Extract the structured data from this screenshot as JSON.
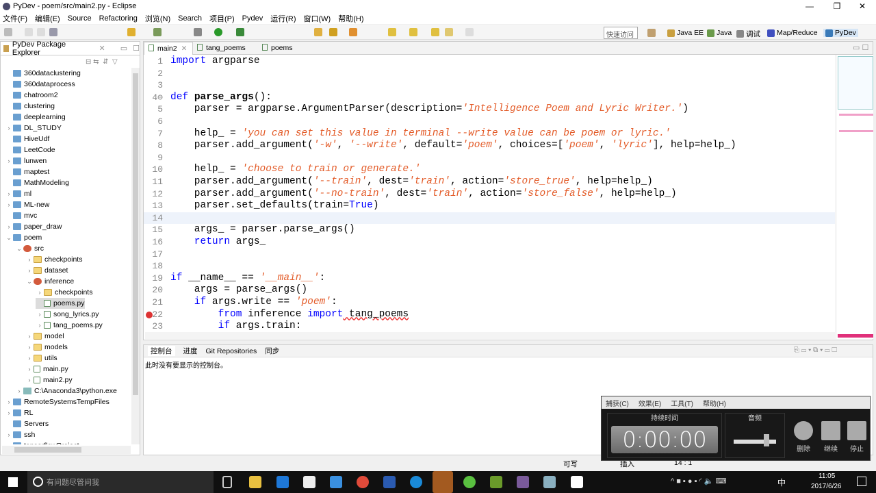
{
  "window": {
    "title": "PyDev - poem/src/main2.py - Eclipse",
    "minimize": "—",
    "maximize": "❐",
    "close": "✕"
  },
  "menu": [
    "文件(F)",
    "编辑(E)",
    "Source",
    "Refactoring",
    "浏览(N)",
    "Search",
    "项目(P)",
    "Pydev",
    "运行(R)",
    "窗口(W)",
    "帮助(H)"
  ],
  "toolbar": {
    "quick_access": "快速访问",
    "perspectives": [
      {
        "label": "Java EE",
        "color": "#c9a040"
      },
      {
        "label": "Java",
        "color": "#6a9a4a"
      },
      {
        "label": "调试",
        "color": "#888888"
      },
      {
        "label": "Map/Reduce",
        "color": "#4050c0"
      },
      {
        "label": "PyDev",
        "color": "#3a7ab8",
        "active": true
      }
    ]
  },
  "explorer": {
    "title": "PyDev Package Explorer",
    "tree": [
      {
        "label": "360dataclustering",
        "level": 0,
        "type": "project",
        "arrow": ""
      },
      {
        "label": "360dataprocess",
        "level": 0,
        "type": "project",
        "arrow": ""
      },
      {
        "label": "chatroom2",
        "level": 0,
        "type": "project",
        "arrow": ""
      },
      {
        "label": "clustering",
        "level": 0,
        "type": "project",
        "arrow": ""
      },
      {
        "label": "deeplearning",
        "level": 0,
        "type": "project",
        "arrow": ""
      },
      {
        "label": "DL_STUDY",
        "level": 0,
        "type": "project",
        "arrow": "›"
      },
      {
        "label": "HiveUdf",
        "level": 0,
        "type": "project",
        "arrow": ""
      },
      {
        "label": "LeetCode",
        "level": 0,
        "type": "project",
        "arrow": ""
      },
      {
        "label": "lunwen",
        "level": 0,
        "type": "project",
        "arrow": "›"
      },
      {
        "label": "maptest",
        "level": 0,
        "type": "project",
        "arrow": ""
      },
      {
        "label": "MathModeling",
        "level": 0,
        "type": "project",
        "arrow": ""
      },
      {
        "label": "ml",
        "level": 0,
        "type": "project",
        "arrow": "›"
      },
      {
        "label": "ML-new",
        "level": 0,
        "type": "project",
        "arrow": "›"
      },
      {
        "label": "mvc",
        "level": 0,
        "type": "project",
        "arrow": ""
      },
      {
        "label": "paper_draw",
        "level": 0,
        "type": "project",
        "arrow": "›"
      },
      {
        "label": "poem",
        "level": 0,
        "type": "project",
        "arrow": "⌄"
      },
      {
        "label": "src",
        "level": 1,
        "type": "package",
        "arrow": "⌄"
      },
      {
        "label": "checkpoints",
        "level": 2,
        "type": "folder",
        "arrow": "›"
      },
      {
        "label": "dataset",
        "level": 2,
        "type": "folder",
        "arrow": "›"
      },
      {
        "label": "inference",
        "level": 2,
        "type": "package",
        "arrow": "⌄"
      },
      {
        "label": "checkpoints",
        "level": 3,
        "type": "folder",
        "arrow": "›"
      },
      {
        "label": "poems.py",
        "level": 3,
        "type": "file",
        "arrow": "",
        "selected": true
      },
      {
        "label": "song_lyrics.py",
        "level": 3,
        "type": "file",
        "arrow": "›"
      },
      {
        "label": "tang_poems.py",
        "level": 3,
        "type": "file",
        "arrow": "›"
      },
      {
        "label": "model",
        "level": 2,
        "type": "folder",
        "arrow": "›"
      },
      {
        "label": "models",
        "level": 2,
        "type": "folder",
        "arrow": "›"
      },
      {
        "label": "utils",
        "level": 2,
        "type": "folder",
        "arrow": "›"
      },
      {
        "label": "main.py",
        "level": 2,
        "type": "file",
        "arrow": "›"
      },
      {
        "label": "main2.py",
        "level": 2,
        "type": "file",
        "arrow": "›"
      },
      {
        "label": "C:\\Anaconda3\\python.exe",
        "level": 1,
        "type": "interp",
        "arrow": "›"
      },
      {
        "label": "RemoteSystemsTempFiles",
        "level": 0,
        "type": "project",
        "arrow": "›"
      },
      {
        "label": "RL",
        "level": 0,
        "type": "project",
        "arrow": "›"
      },
      {
        "label": "Servers",
        "level": 0,
        "type": "project",
        "arrow": ""
      },
      {
        "label": "ssh",
        "level": 0,
        "type": "project",
        "arrow": "›"
      },
      {
        "label": "tensorflowProject",
        "level": 0,
        "type": "project",
        "arrow": "›"
      }
    ]
  },
  "editor": {
    "tabs": [
      {
        "label": "main2",
        "active": true
      },
      {
        "label": "tang_poems"
      },
      {
        "label": "poems"
      }
    ],
    "current_line": 14,
    "lines": [
      [
        [
          "kw",
          "import"
        ],
        [
          "pl",
          " argparse"
        ]
      ],
      [],
      [],
      [
        [
          "kw",
          "def "
        ],
        [
          "fn",
          "parse_args"
        ],
        [
          "pl",
          "():"
        ]
      ],
      [
        [
          "pl",
          "    parser = argparse.ArgumentParser(description="
        ],
        [
          "str",
          "'Intelligence Poem and Lyric Writer.'"
        ],
        [
          "pl",
          ")"
        ]
      ],
      [],
      [
        [
          "pl",
          "    help_ = "
        ],
        [
          "str",
          "'you can set this value in terminal --write value can be poem or lyric.'"
        ]
      ],
      [
        [
          "pl",
          "    parser.add_argument("
        ],
        [
          "str",
          "'-w'"
        ],
        [
          "pl",
          ", "
        ],
        [
          "str",
          "'--write'"
        ],
        [
          "pl",
          ", default="
        ],
        [
          "str",
          "'poem'"
        ],
        [
          "pl",
          ", choices=["
        ],
        [
          "str",
          "'poem'"
        ],
        [
          "pl",
          ", "
        ],
        [
          "str",
          "'lyric'"
        ],
        [
          "pl",
          "], help=help_)"
        ]
      ],
      [],
      [
        [
          "pl",
          "    help_ = "
        ],
        [
          "str",
          "'choose to train or generate.'"
        ]
      ],
      [
        [
          "pl",
          "    parser.add_argument("
        ],
        [
          "str",
          "'--train'"
        ],
        [
          "pl",
          ", dest="
        ],
        [
          "str",
          "'train'"
        ],
        [
          "pl",
          ", action="
        ],
        [
          "str",
          "'store_true'"
        ],
        [
          "pl",
          ", help=help_)"
        ]
      ],
      [
        [
          "pl",
          "    parser.add_argument("
        ],
        [
          "str",
          "'--no-train'"
        ],
        [
          "pl",
          ", dest="
        ],
        [
          "str",
          "'train'"
        ],
        [
          "pl",
          ", action="
        ],
        [
          "str",
          "'store_false'"
        ],
        [
          "pl",
          ", help=help_)"
        ]
      ],
      [
        [
          "pl",
          "    parser.set_defaults(train="
        ],
        [
          "kw",
          "True"
        ],
        [
          "pl",
          ")"
        ]
      ],
      [],
      [
        [
          "pl",
          "    args_ = parser.parse_args()"
        ]
      ],
      [
        [
          "kw",
          "    return"
        ],
        [
          "pl",
          " args_"
        ]
      ],
      [],
      [],
      [
        [
          "kw",
          "if"
        ],
        [
          "pl",
          " __name__ == "
        ],
        [
          "str",
          "'__main__'"
        ],
        [
          "pl",
          ":"
        ]
      ],
      [
        [
          "pl",
          "    args = parse_args()"
        ]
      ],
      [
        [
          "kw",
          "    if"
        ],
        [
          "pl",
          " args.write == "
        ],
        [
          "str",
          "'poem'"
        ],
        [
          "pl",
          ":"
        ]
      ],
      [
        [
          "kw",
          "        from"
        ],
        [
          "pl",
          " inference "
        ],
        [
          "kw",
          "import"
        ],
        [
          "pl",
          " tang_poems"
        ]
      ],
      [
        [
          "kw",
          "        if"
        ],
        [
          "pl",
          " args.train:"
        ]
      ]
    ]
  },
  "console": {
    "tabs": [
      "控制台",
      "进度",
      "Git Repositories",
      "同步"
    ],
    "message": "此时没有要显示的控制台。"
  },
  "status": {
    "writable": "可写",
    "insert": "插入",
    "position": "14 : 1"
  },
  "recorder": {
    "menu": [
      "捕获(C)",
      "效果(E)",
      "工具(T)",
      "帮助(H)"
    ],
    "duration_label": "持续时间",
    "time": "0:00:00",
    "audio_label": "音频",
    "buttons": [
      "删除",
      "继续",
      "停止"
    ]
  },
  "taskbar": {
    "search_placeholder": "有问题尽管问我",
    "time": "11:05",
    "date": "2017/6/26",
    "ime": "中"
  }
}
